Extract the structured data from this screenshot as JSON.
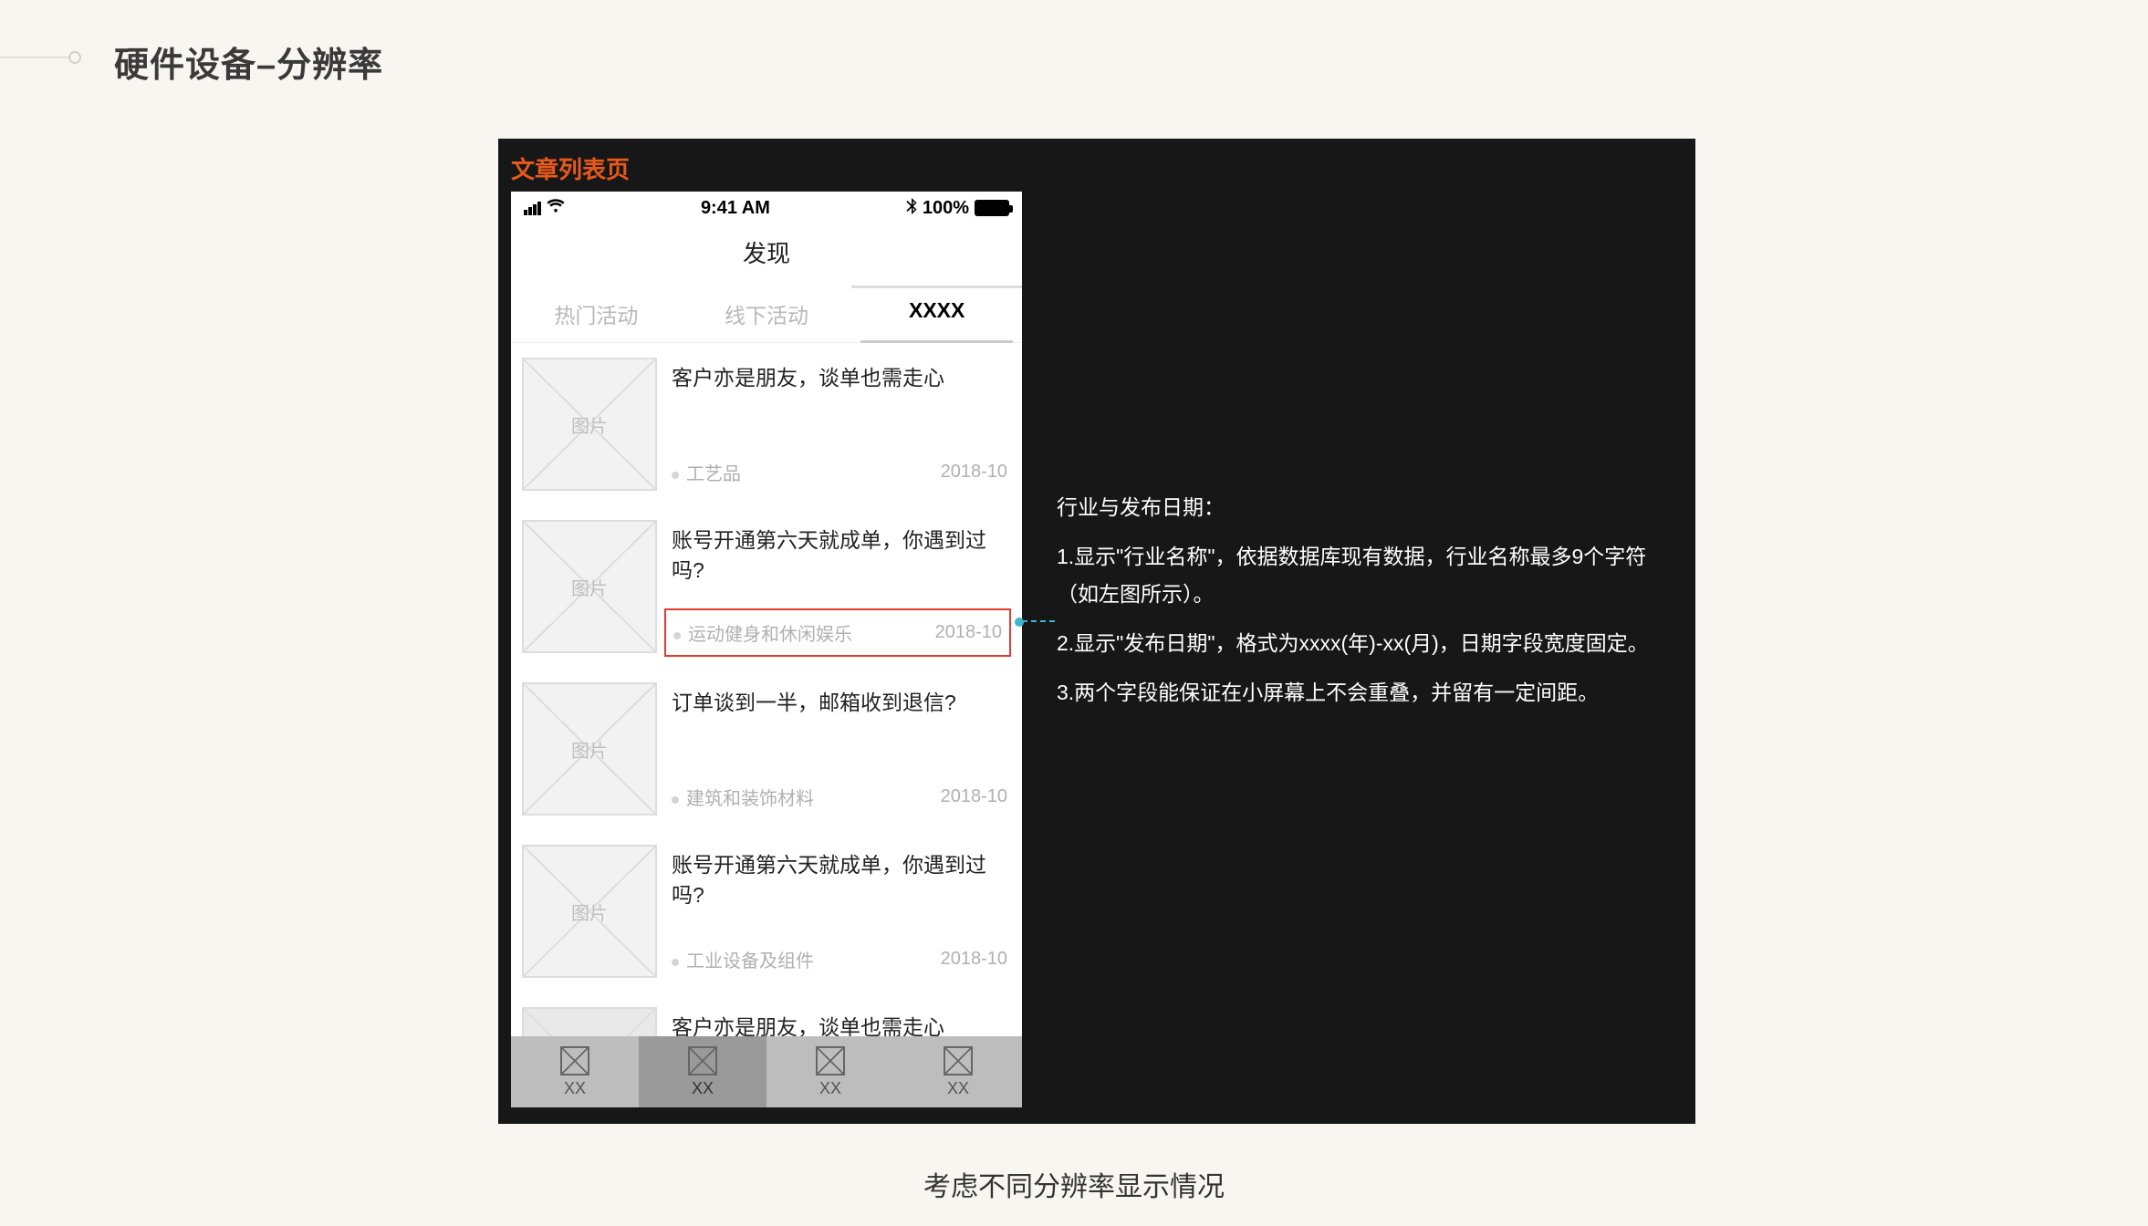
{
  "page": {
    "title": "硬件设备–分辨率",
    "caption": "考虑不同分辨率显示情况"
  },
  "canvas": {
    "mock_title": "文章列表页"
  },
  "statusbar": {
    "time": "9:41 AM",
    "battery_pct": "100%"
  },
  "phone": {
    "nav_title": "发现",
    "tabs": [
      "热门活动",
      "线下活动",
      "XXXX"
    ],
    "active_tab_index": 2,
    "thumb_label": "图片",
    "rows": [
      {
        "title": "客户亦是朋友，谈单也需走心",
        "industry": "工艺品",
        "date": "2018-10",
        "highlight": false
      },
      {
        "title": "账号开通第六天就成单，你遇到过吗?",
        "industry": "运动健身和休闲娱乐",
        "date": "2018-10",
        "highlight": true
      },
      {
        "title": "订单谈到一半，邮箱收到退信?",
        "industry": "建筑和装饰材料",
        "date": "2018-10",
        "highlight": false
      },
      {
        "title": "账号开通第六天就成单，你遇到过吗?",
        "industry": "工业设备及组件",
        "date": "2018-10",
        "highlight": false
      },
      {
        "title": "客户亦是朋友，谈单也需走心",
        "industry": "",
        "date": "",
        "highlight": false
      }
    ],
    "bottom_tabs": [
      "XX",
      "XX",
      "XX",
      "XX"
    ],
    "bottom_active_index": 1
  },
  "annotation": {
    "heading": "行业与发布日期：",
    "line1": "1.显示\"行业名称\"，依据数据库现有数据，行业名称最多9个字符（如左图所示）。",
    "line2": "2.显示\"发布日期\"，格式为xxxx(年)-xx(月)，日期字段宽度固定。",
    "line3": "3.两个字段能保证在小屏幕上不会重叠，并留有一定间距。"
  }
}
